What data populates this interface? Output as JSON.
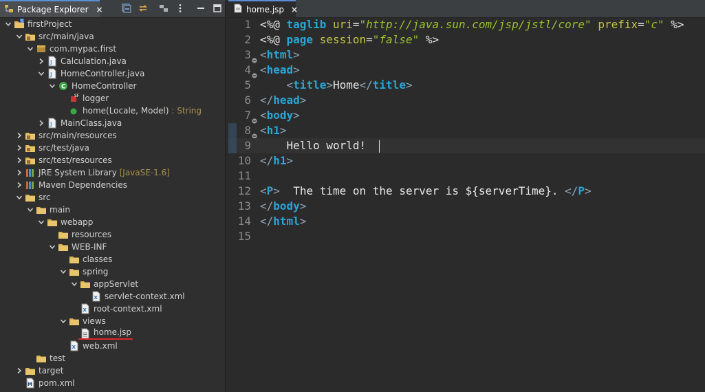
{
  "explorer": {
    "tab_label": "Package Explorer",
    "close_glyph": "×",
    "toolbar": [
      "collapse-all-icon",
      "link-with-editor-icon",
      "focus-icon",
      "view-menu-icon",
      "minimize-icon",
      "maximize-icon"
    ],
    "tree": [
      {
        "label": "firstProject",
        "depth": 0,
        "twisty": "open",
        "icon": "project-icon"
      },
      {
        "label": "src/main/java",
        "depth": 1,
        "twisty": "open",
        "icon": "source-folder-icon"
      },
      {
        "label": "com.mypac.first",
        "depth": 2,
        "twisty": "open",
        "icon": "package-icon"
      },
      {
        "label": "Calculation.java",
        "depth": 3,
        "twisty": "closed",
        "icon": "java-file-icon"
      },
      {
        "label": "HomeController.java",
        "depth": 3,
        "twisty": "open",
        "icon": "java-file-icon"
      },
      {
        "label": "HomeController",
        "depth": 4,
        "twisty": "open",
        "icon": "class-icon"
      },
      {
        "label": "logger",
        "depth": 5,
        "twisty": "none",
        "icon": "field-icon"
      },
      {
        "label": "home(Locale, Model)",
        "suffix": " : String",
        "depth": 5,
        "twisty": "none",
        "icon": "method-icon"
      },
      {
        "label": "MainClass.java",
        "depth": 3,
        "twisty": "closed",
        "icon": "java-file-icon"
      },
      {
        "label": "src/main/resources",
        "depth": 1,
        "twisty": "closed",
        "icon": "source-folder-icon"
      },
      {
        "label": "src/test/java",
        "depth": 1,
        "twisty": "closed",
        "icon": "source-folder-icon"
      },
      {
        "label": "src/test/resources",
        "depth": 1,
        "twisty": "closed",
        "icon": "source-folder-icon"
      },
      {
        "label": "JRE System Library",
        "suffix": " [JavaSE-1.6]",
        "depth": 1,
        "twisty": "closed",
        "icon": "library-icon"
      },
      {
        "label": "Maven Dependencies",
        "depth": 1,
        "twisty": "closed",
        "icon": "library-icon"
      },
      {
        "label": "src",
        "depth": 1,
        "twisty": "open",
        "icon": "folder-icon"
      },
      {
        "label": "main",
        "depth": 2,
        "twisty": "open",
        "icon": "folder-icon"
      },
      {
        "label": "webapp",
        "depth": 3,
        "twisty": "open",
        "icon": "folder-icon"
      },
      {
        "label": "resources",
        "depth": 4,
        "twisty": "none",
        "icon": "folder-icon"
      },
      {
        "label": "WEB-INF",
        "depth": 4,
        "twisty": "open",
        "icon": "folder-icon"
      },
      {
        "label": "classes",
        "depth": 5,
        "twisty": "none",
        "icon": "folder-icon"
      },
      {
        "label": "spring",
        "depth": 5,
        "twisty": "open",
        "icon": "folder-icon"
      },
      {
        "label": "appServlet",
        "depth": 6,
        "twisty": "open",
        "icon": "folder-icon"
      },
      {
        "label": "servlet-context.xml",
        "depth": 7,
        "twisty": "none",
        "icon": "xml-file-icon"
      },
      {
        "label": "root-context.xml",
        "depth": 6,
        "twisty": "none",
        "icon": "xml-file-icon"
      },
      {
        "label": "views",
        "depth": 5,
        "twisty": "open",
        "icon": "folder-icon"
      },
      {
        "label": "home.jsp",
        "depth": 6,
        "twisty": "none",
        "icon": "jsp-file-icon",
        "underline": true
      },
      {
        "label": "web.xml",
        "depth": 5,
        "twisty": "none",
        "icon": "xml-file-icon"
      },
      {
        "label": "test",
        "depth": 2,
        "twisty": "none",
        "icon": "folder-icon"
      },
      {
        "label": "target",
        "depth": 1,
        "twisty": "closed",
        "icon": "folder-icon"
      },
      {
        "label": "pom.xml",
        "depth": 1,
        "twisty": "none",
        "icon": "maven-file-icon"
      }
    ]
  },
  "editor": {
    "tab_label": "home.jsp",
    "close_glyph": "×",
    "current_line": 9,
    "lines": [
      {
        "n": "1",
        "fold": false,
        "tokens": [
          [
            "jsp",
            "<%@ "
          ],
          [
            "tag",
            "taglib "
          ],
          [
            "attr",
            "uri"
          ],
          [
            "eq",
            "="
          ],
          [
            "str",
            "\"http://java.sun.com/jsp/jstl/core\""
          ],
          [
            "plain",
            " "
          ],
          [
            "attr",
            "prefix"
          ],
          [
            "eq",
            "="
          ],
          [
            "str",
            "\"c\""
          ],
          [
            "jsp",
            " %>"
          ]
        ]
      },
      {
        "n": "2",
        "fold": false,
        "tokens": [
          [
            "jsp",
            "<%@ "
          ],
          [
            "tag",
            "page "
          ],
          [
            "attr",
            "session"
          ],
          [
            "eq",
            "="
          ],
          [
            "str",
            "\"false\""
          ],
          [
            "jsp",
            " %>"
          ]
        ]
      },
      {
        "n": "3",
        "fold": true,
        "tokens": [
          [
            "brk",
            "<"
          ],
          [
            "tag",
            "html"
          ],
          [
            "brk",
            ">"
          ]
        ]
      },
      {
        "n": "4",
        "fold": true,
        "tokens": [
          [
            "brk",
            "<"
          ],
          [
            "tag",
            "head"
          ],
          [
            "brk",
            ">"
          ]
        ]
      },
      {
        "n": "5",
        "fold": false,
        "tokens": [
          [
            "plain",
            "    "
          ],
          [
            "brk",
            "<"
          ],
          [
            "tag",
            "title"
          ],
          [
            "brk",
            ">"
          ],
          [
            "plain",
            "Home"
          ],
          [
            "brk",
            "</"
          ],
          [
            "tag",
            "title"
          ],
          [
            "brk",
            ">"
          ]
        ]
      },
      {
        "n": "6",
        "fold": false,
        "tokens": [
          [
            "brk",
            "</"
          ],
          [
            "tag",
            "head"
          ],
          [
            "brk",
            ">"
          ]
        ]
      },
      {
        "n": "7",
        "fold": true,
        "tokens": [
          [
            "brk",
            "<"
          ],
          [
            "tag",
            "body"
          ],
          [
            "brk",
            ">"
          ]
        ]
      },
      {
        "n": "8",
        "fold": true,
        "tokens": [
          [
            "brk",
            "<"
          ],
          [
            "tag",
            "h1"
          ],
          [
            "brk",
            ">"
          ]
        ]
      },
      {
        "n": "9",
        "fold": false,
        "tokens": [
          [
            "plain",
            "    Hello world!  "
          ]
        ],
        "caret": true
      },
      {
        "n": "10",
        "fold": false,
        "tokens": [
          [
            "brk",
            "</"
          ],
          [
            "tag",
            "h1"
          ],
          [
            "brk",
            ">"
          ]
        ]
      },
      {
        "n": "11",
        "fold": false,
        "tokens": []
      },
      {
        "n": "12",
        "fold": false,
        "tokens": [
          [
            "brk",
            "<"
          ],
          [
            "tag",
            "P"
          ],
          [
            "brk",
            ">"
          ],
          [
            "plain",
            "  The time on the server is ${serverTime}. "
          ],
          [
            "brk",
            "</"
          ],
          [
            "tag",
            "P"
          ],
          [
            "brk",
            ">"
          ]
        ]
      },
      {
        "n": "13",
        "fold": false,
        "tokens": [
          [
            "brk",
            "</"
          ],
          [
            "tag",
            "body"
          ],
          [
            "brk",
            ">"
          ]
        ]
      },
      {
        "n": "14",
        "fold": false,
        "tokens": [
          [
            "brk",
            "</"
          ],
          [
            "tag",
            "html"
          ],
          [
            "brk",
            ">"
          ]
        ]
      },
      {
        "n": "15",
        "fold": false,
        "tokens": []
      }
    ]
  },
  "colors": {
    "accent": "#5a8fd6",
    "underline": "#e0262a",
    "folder": "#d9b253",
    "java": "#5fa0e0",
    "class_green": "#3ca845"
  }
}
